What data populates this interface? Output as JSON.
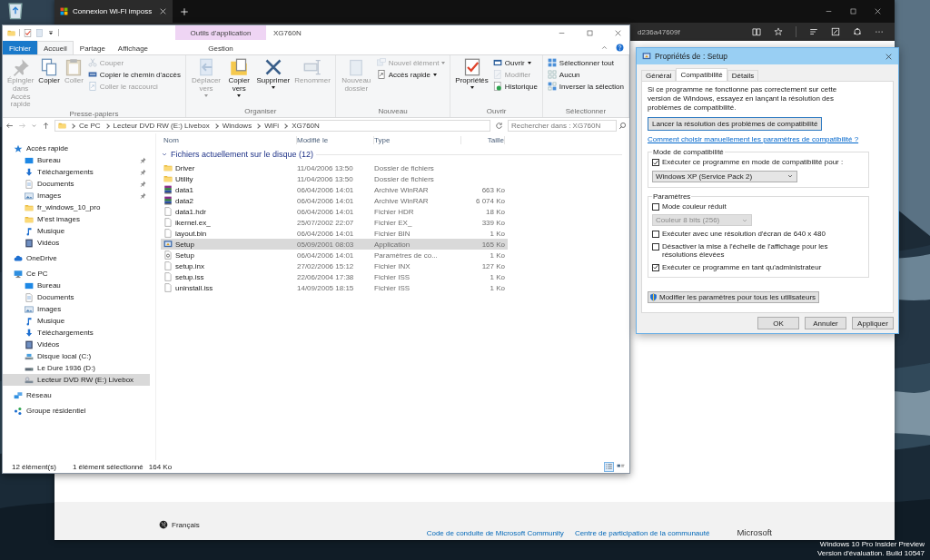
{
  "browser": {
    "tab_title": "Connexion Wi-FI imposs",
    "address_fragment": "d236a47609f",
    "footer": {
      "language": "Français",
      "links": [
        "Code de conduite de Microsoft Community",
        "Centre de participation de la communauté"
      ],
      "brand": "Microsoft"
    }
  },
  "explorer": {
    "title": "XG760N",
    "context_group": "Outils d'application",
    "tabs": [
      {
        "label": "Fichier",
        "kind": "file",
        "selected": false
      },
      {
        "label": "Accueil",
        "kind": "tab",
        "selected": true
      },
      {
        "label": "Partage",
        "kind": "tab",
        "selected": false
      },
      {
        "label": "Affichage",
        "kind": "tab",
        "selected": false
      },
      {
        "label": "Gestion",
        "kind": "context",
        "selected": false
      }
    ],
    "ribbon_groups": [
      {
        "label": "Presse-papiers",
        "items": [
          {
            "kind": "large",
            "label": "Épingler dans Accès rapide",
            "disabled": true,
            "dropdown": false
          },
          {
            "kind": "large",
            "label": "Copier",
            "disabled": false,
            "dropdown": false
          },
          {
            "kind": "large",
            "label": "Coller",
            "disabled": true,
            "dropdown": false
          },
          {
            "kind": "small",
            "label": "Couper",
            "disabled": true,
            "dropdown": false
          },
          {
            "kind": "small",
            "label": "Copier le chemin d'accès",
            "disabled": false,
            "dropdown": false
          },
          {
            "kind": "small",
            "label": "Coller le raccourci",
            "disabled": true,
            "dropdown": false
          }
        ]
      },
      {
        "label": "Organiser",
        "items": [
          {
            "kind": "large",
            "label": "Déplacer vers",
            "disabled": true,
            "dropdown": true
          },
          {
            "kind": "large",
            "label": "Copier vers",
            "disabled": false,
            "dropdown": true
          },
          {
            "kind": "large",
            "label": "Supprimer",
            "disabled": false,
            "dropdown": true
          },
          {
            "kind": "large",
            "label": "Renommer",
            "disabled": true,
            "dropdown": false
          }
        ]
      },
      {
        "label": "Nouveau",
        "items": [
          {
            "kind": "large",
            "label": "Nouveau dossier",
            "disabled": true,
            "dropdown": false
          },
          {
            "kind": "small",
            "label": "Nouvel élément",
            "disabled": true,
            "dropdown": true
          },
          {
            "kind": "small",
            "label": "Accès rapide",
            "disabled": false,
            "dropdown": true
          }
        ]
      },
      {
        "label": "Ouvrir",
        "items": [
          {
            "kind": "large",
            "label": "Propriétés",
            "disabled": false,
            "dropdown": true
          },
          {
            "kind": "small",
            "label": "Ouvrir",
            "disabled": false,
            "dropdown": true
          },
          {
            "kind": "small",
            "label": "Modifier",
            "disabled": true,
            "dropdown": false
          },
          {
            "kind": "small",
            "label": "Historique",
            "disabled": false,
            "dropdown": false
          }
        ]
      },
      {
        "label": "Sélectionner",
        "items": [
          {
            "kind": "small",
            "label": "Sélectionner tout",
            "disabled": false,
            "dropdown": false
          },
          {
            "kind": "small",
            "label": "Aucun",
            "disabled": false,
            "dropdown": false
          },
          {
            "kind": "small",
            "label": "Inverser la sélection",
            "disabled": false,
            "dropdown": false
          }
        ]
      }
    ],
    "breadcrumbs": [
      "Ce PC",
      "Lecteur DVD RW (E:) Livebox",
      "Windows",
      "WiFi",
      "XG760N"
    ],
    "search": {
      "placeholder": "Rechercher dans : XG760N"
    },
    "nav": [
      {
        "label": "Accès rapide",
        "kind": "star",
        "selected": false,
        "children": [
          {
            "label": "Bureau",
            "kind": "desktop",
            "pinned": true,
            "selected": false
          },
          {
            "label": "Téléchargements",
            "kind": "download",
            "pinned": true,
            "selected": false
          },
          {
            "label": "Documents",
            "kind": "docs",
            "pinned": true,
            "selected": false
          },
          {
            "label": "Images",
            "kind": "images",
            "pinned": true,
            "selected": false
          },
          {
            "label": "fr_windows_10_pro",
            "kind": "folder",
            "pinned": false,
            "selected": false
          },
          {
            "label": "M'est images",
            "kind": "folder",
            "pinned": false,
            "selected": false
          },
          {
            "label": "Musique",
            "kind": "music",
            "pinned": false,
            "selected": false
          },
          {
            "label": "Vidéos",
            "kind": "video",
            "pinned": false,
            "selected": false
          }
        ]
      },
      {
        "label": "OneDrive",
        "kind": "cloud",
        "selected": false
      },
      {
        "label": "Ce PC",
        "kind": "pc",
        "selected": false,
        "children": [
          {
            "label": "Bureau",
            "kind": "desktop",
            "selected": false
          },
          {
            "label": "Documents",
            "kind": "docs",
            "selected": false
          },
          {
            "label": "Images",
            "kind": "images",
            "selected": false
          },
          {
            "label": "Musique",
            "kind": "music",
            "selected": false
          },
          {
            "label": "Téléchargements",
            "kind": "download",
            "selected": false
          },
          {
            "label": "Vidéos",
            "kind": "video",
            "selected": false
          },
          {
            "label": "Disque local (C:)",
            "kind": "drive",
            "selected": false
          },
          {
            "label": "Le Dure 1936 (D:)",
            "kind": "hdd",
            "selected": false
          },
          {
            "label": "Lecteur DVD RW (E:) Livebox",
            "kind": "dvd",
            "selected": true
          }
        ]
      },
      {
        "label": "Réseau",
        "kind": "network",
        "selected": false
      },
      {
        "label": "Groupe résidentiel",
        "kind": "homegroup",
        "selected": false
      }
    ],
    "columns": [
      "Nom",
      "Modifié le",
      "Type",
      "Taille"
    ],
    "group_header": "Fichiers actuellement sur le disque (12)",
    "files": [
      {
        "name": "Driver",
        "kind": "folder",
        "modified": "11/04/2006 13:50",
        "type": "Dossier de fichiers",
        "selected": false
      },
      {
        "name": "Utility",
        "kind": "folder",
        "modified": "11/04/2006 13:50",
        "type": "Dossier de fichiers",
        "selected": false
      },
      {
        "name": "data1",
        "kind": "archive",
        "modified": "06/04/2006 14:01",
        "type": "Archive WinRAR",
        "size": "663 Ko",
        "selected": false
      },
      {
        "name": "data2",
        "kind": "archive",
        "modified": "06/04/2006 14:01",
        "type": "Archive WinRAR",
        "size": "6 074 Ko",
        "selected": false
      },
      {
        "name": "data1.hdr",
        "kind": "file",
        "modified": "06/04/2006 14:01",
        "type": "Fichier HDR",
        "size": "18 Ko",
        "selected": false
      },
      {
        "name": "ikernel.ex_",
        "kind": "file",
        "modified": "25/07/2002 22:07",
        "type": "Fichier EX_",
        "size": "339 Ko",
        "selected": false
      },
      {
        "name": "layout.bin",
        "kind": "file",
        "modified": "06/04/2006 14:01",
        "type": "Fichier BIN",
        "size": "1 Ko",
        "selected": false
      },
      {
        "name": "Setup",
        "kind": "app",
        "modified": "05/09/2001 08:03",
        "type": "Application",
        "size": "165 Ko",
        "selected": true
      },
      {
        "name": "Setup",
        "kind": "settings",
        "modified": "06/04/2006 14:01",
        "type": "Paramètres de co...",
        "size": "1 Ko",
        "selected": false
      },
      {
        "name": "setup.inx",
        "kind": "file",
        "modified": "27/02/2006 15:12",
        "type": "Fichier INX",
        "size": "127 Ko",
        "selected": false
      },
      {
        "name": "setup.iss",
        "kind": "file",
        "modified": "22/06/2004 17:38",
        "type": "Fichier ISS",
        "size": "1 Ko",
        "selected": false
      },
      {
        "name": "uninstall.iss",
        "kind": "file",
        "modified": "14/09/2005 18:15",
        "type": "Fichier ISS",
        "size": "1 Ko",
        "selected": false
      }
    ],
    "status": {
      "count": "12 élément(s)",
      "selection": "1 élément sélectionné",
      "selection_size": "164 Ko"
    },
    "views": [
      {
        "kind": "details",
        "selected": true
      },
      {
        "kind": "tiles",
        "selected": false
      }
    ]
  },
  "dialog": {
    "title": "Propriétés de : Setup",
    "tabs": [
      {
        "label": "Général",
        "selected": false
      },
      {
        "label": "Compatibilité",
        "selected": true
      },
      {
        "label": "Détails",
        "selected": false
      }
    ],
    "intro": "Si ce programme ne fonctionne pas correctement sur cette version de Windows, essayez en lançant la résolution des problèmes de compatibilité.",
    "troubleshoot_button": "Lancer la résolution des problèmes de compatibilité",
    "help_link": "Comment choisir manuellement les paramètres de compatibilité ?",
    "groups": [
      {
        "label": "Mode de compatibilité",
        "options": [
          {
            "kind": "checkbox",
            "label": "Exécuter ce programme en mode de compatibilité pour :",
            "checked": true
          },
          {
            "kind": "select",
            "value": "Windows XP (Service Pack 2)",
            "disabled": false
          }
        ]
      },
      {
        "label": "Paramètres",
        "options": [
          {
            "kind": "checkbox",
            "label": "Mode couleur réduit",
            "checked": false
          },
          {
            "kind": "select",
            "value": "Couleur 8 bits (256)",
            "disabled": true
          },
          {
            "kind": "checkbox",
            "label": "Exécuter avec une résolution d'écran de 640 x 480",
            "checked": false
          },
          {
            "kind": "checkbox",
            "label": "Désactiver la mise à l'échelle de l'affichage pour les résolutions élevées",
            "checked": false
          },
          {
            "kind": "checkbox",
            "label": "Exécuter ce programme en tant qu'administrateur",
            "checked": true
          }
        ]
      }
    ],
    "all_users_button": "Modifier les paramètres pour tous les utilisateurs",
    "buttons": [
      "OK",
      "Annuler",
      "Appliquer"
    ]
  },
  "os_notice": [
    "Windows 10 Pro Insider Preview",
    "Version d'évaluation. Build 10547"
  ]
}
